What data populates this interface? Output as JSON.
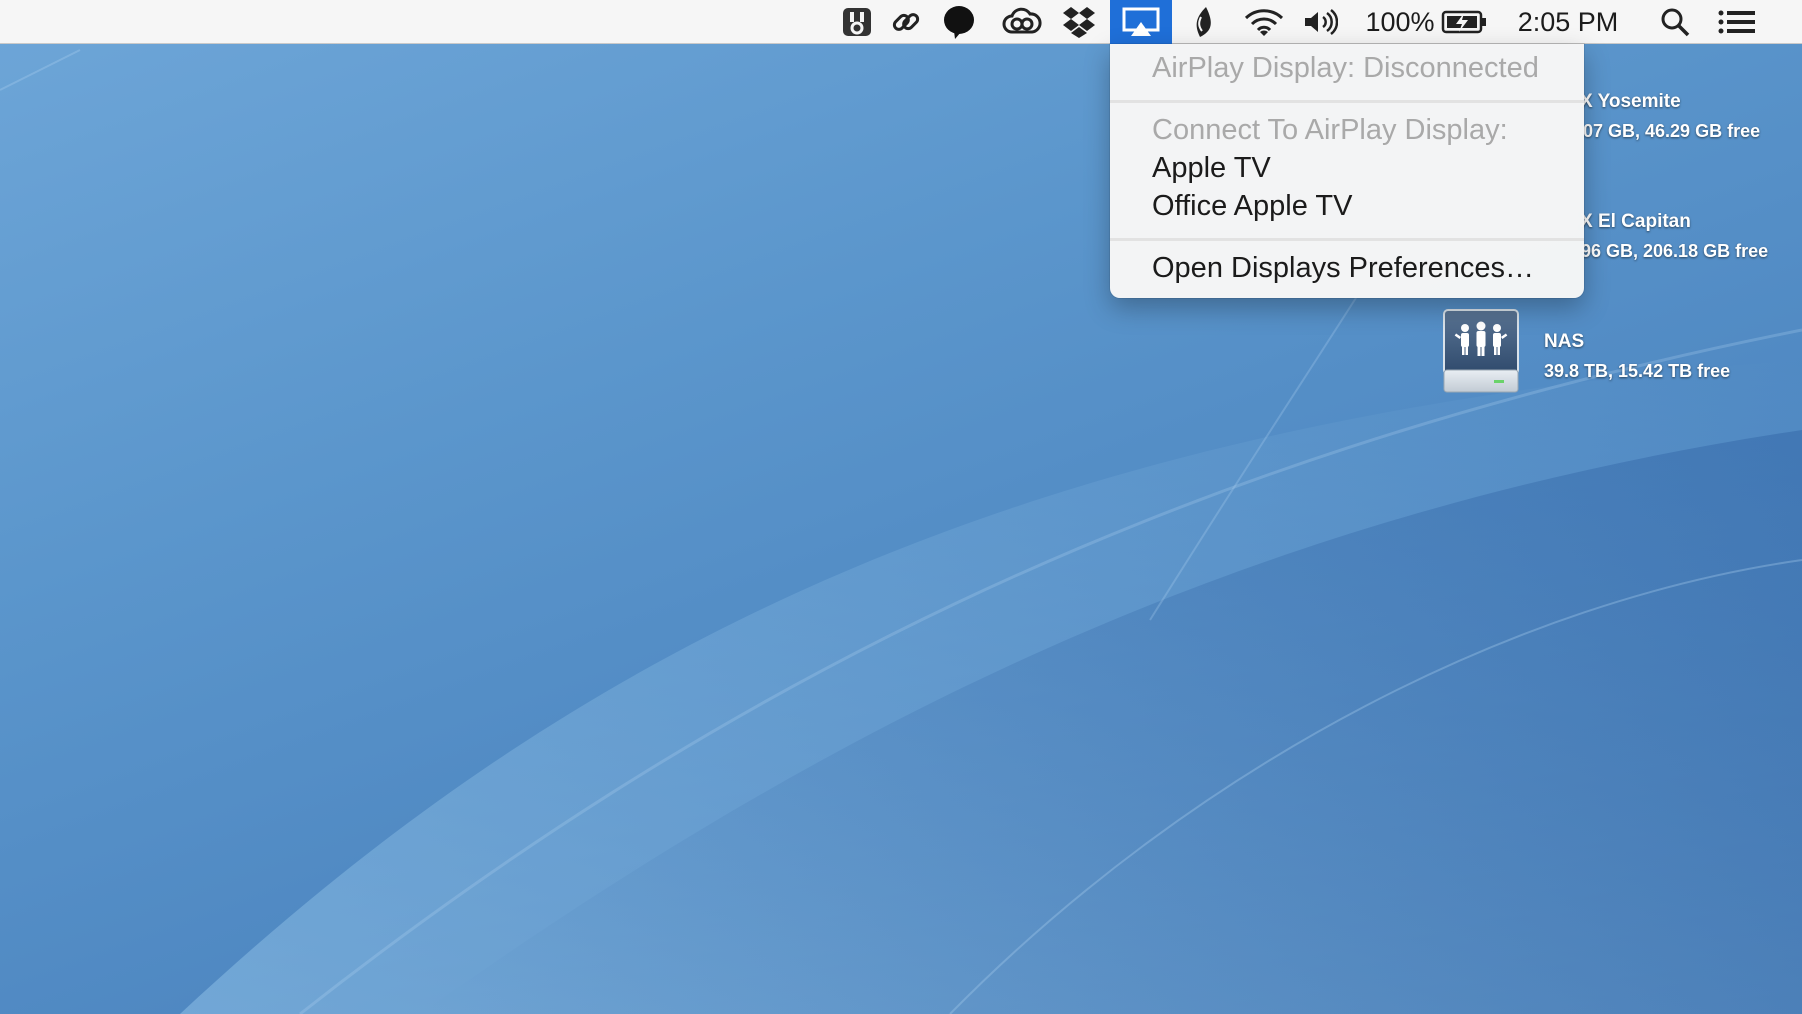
{
  "menubar": {
    "battery_percent": "100%",
    "clock": "2:05 PM",
    "icons": [
      "audio-hijack-icon",
      "link-icon",
      "speech-bubble-icon",
      "creative-cloud-icon",
      "dropbox-icon",
      "airplay-icon",
      "flux-icon",
      "wifi-icon",
      "volume-icon",
      "battery-icon",
      "spotlight-icon",
      "notification-center-icon"
    ],
    "airplay_highlight_color": "#1f6fd8"
  },
  "airplay_menu": {
    "status": "AirPlay Display: Disconnected",
    "connect_header": "Connect To AirPlay Display:",
    "devices": [
      "Apple TV",
      "Office Apple TV"
    ],
    "preferences": "Open Displays Preferences…"
  },
  "desktop": {
    "volumes": [
      {
        "name_visible": "X Yosemite",
        "info_visible": "07 GB, 46.29 GB free"
      },
      {
        "name_visible": "X El Capitan",
        "info_visible": "96 GB, 206.18 GB free"
      },
      {
        "name": "NAS",
        "info": "39.8 TB, 15.42 TB free",
        "icon": "network-drive-icon"
      }
    ]
  }
}
